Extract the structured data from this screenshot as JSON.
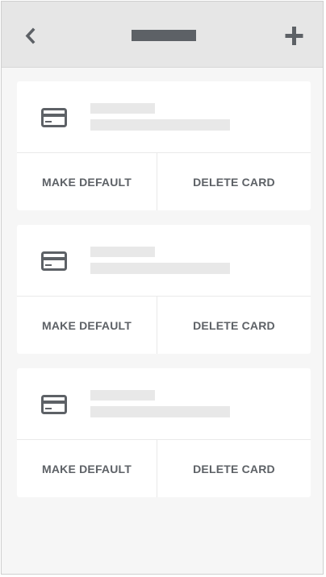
{
  "header": {
    "back_icon": "chevron-left-icon",
    "title_placeholder_color": "#5d6166",
    "add_icon": "plus-icon"
  },
  "colors": {
    "icon": "#5d6166",
    "placeholder": "#e8e8e8",
    "divider": "#e9e9e9",
    "background": "#f6f6f6",
    "topbar": "#e6e6e6"
  },
  "cards": [
    {
      "icon": "credit-card-icon",
      "make_default_label": "MAKE DEFAULT",
      "delete_label": "DELETE CARD"
    },
    {
      "icon": "credit-card-icon",
      "make_default_label": "MAKE DEFAULT",
      "delete_label": "DELETE CARD"
    },
    {
      "icon": "credit-card-icon",
      "make_default_label": "MAKE DEFAULT",
      "delete_label": "DELETE CARD"
    }
  ]
}
